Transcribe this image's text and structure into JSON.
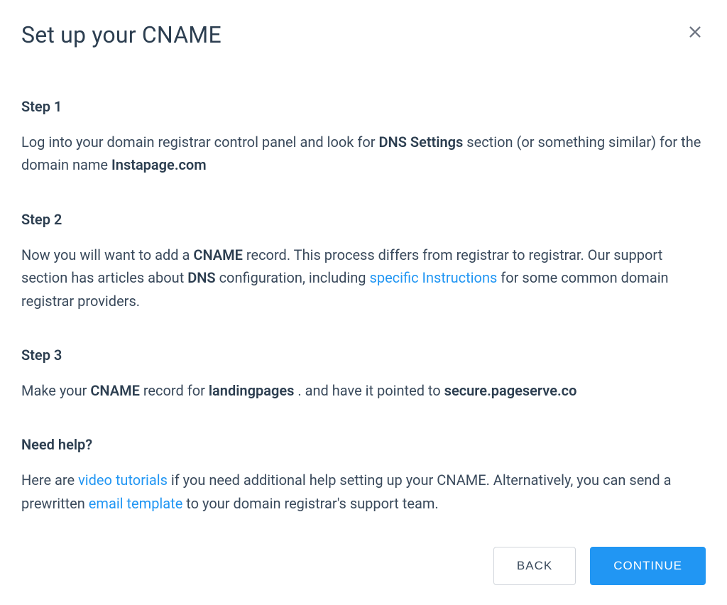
{
  "modal": {
    "title": "Set up your CNAME",
    "steps": [
      {
        "heading": "Step 1",
        "text_parts": {
          "before1": "Log into your domain registrar control panel and look for ",
          "bold1": "DNS Settings",
          "mid1": " section (or something similar) for the domain name ",
          "bold2": "Instapage.com"
        }
      },
      {
        "heading": "Step 2",
        "text_parts": {
          "before1": "Now you will want to add a ",
          "bold1": "CNAME",
          "mid1": " record. This process differs from registrar to registrar. Our support section has articles about ",
          "bold2": "DNS",
          "mid2": " configuration, including ",
          "link1": "specific Instructions",
          "after1": " for some common domain registrar providers."
        }
      },
      {
        "heading": "Step 3",
        "text_parts": {
          "before1": "Make your ",
          "bold1": "CNAME",
          "mid1": " record for ",
          "bold2": "landingpages",
          "mid2": ". and have it pointed to ",
          "bold3": "secure.pageserve.co"
        }
      }
    ],
    "help": {
      "heading": "Need help?",
      "text_parts": {
        "before1": "Here are ",
        "link1": "video tutorials",
        "mid1": " if you need additional help setting up your CNAME. Alternatively, you can send a prewritten ",
        "link2": "email template",
        "after1": " to your domain registrar's support team."
      }
    },
    "buttons": {
      "back": "BACK",
      "continue": "CONTINUE"
    }
  }
}
